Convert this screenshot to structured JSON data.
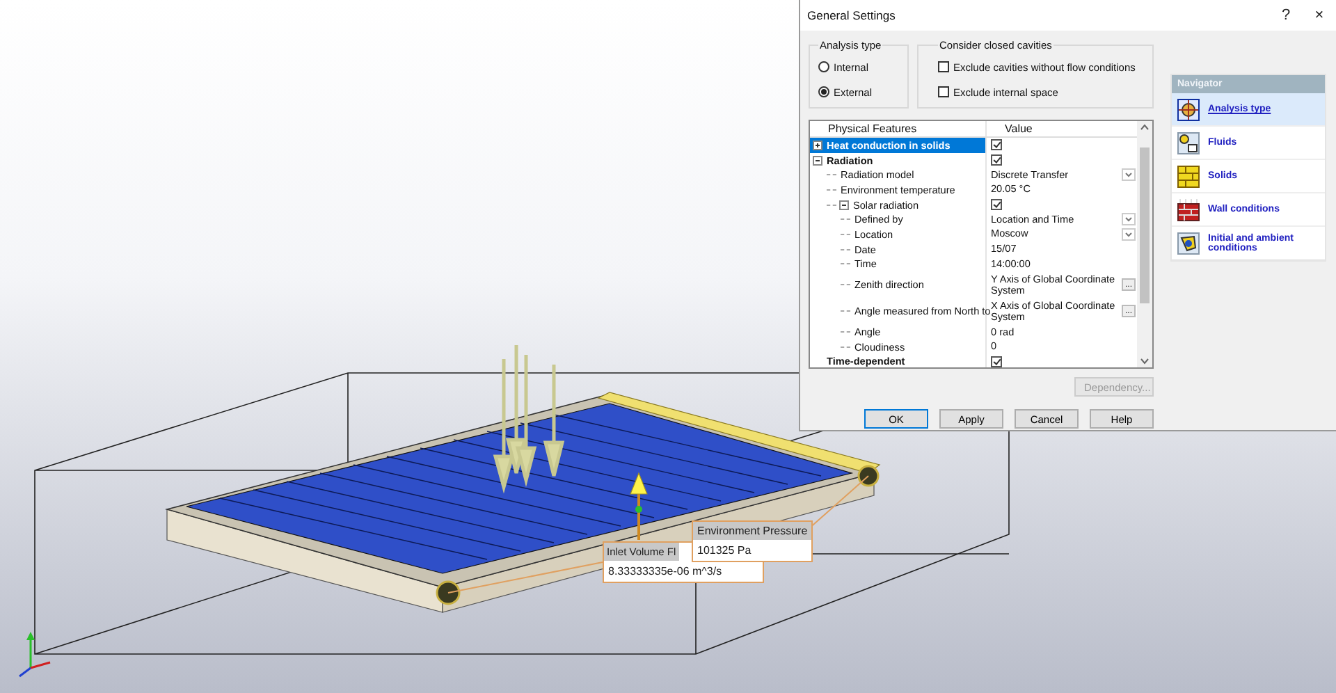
{
  "viewport": {
    "callouts": [
      {
        "title": "Environment Pressure",
        "value": "101325 Pa"
      },
      {
        "title": "Inlet Volume Fl",
        "value": "8.33333335e-06 m^3/s"
      }
    ]
  },
  "dialog": {
    "title": "General Settings",
    "help_button": "?",
    "close_button": "×",
    "analysis_type": {
      "label": "Analysis type",
      "options": [
        {
          "label": "Internal",
          "selected": false
        },
        {
          "label": "External",
          "selected": true
        }
      ]
    },
    "closed_cavities": {
      "label": "Consider closed cavities",
      "options": [
        {
          "label": "Exclude cavities without flow conditions",
          "checked": false
        },
        {
          "label": "Exclude internal space",
          "checked": false
        }
      ]
    },
    "features": {
      "columns": [
        "Physical Features",
        "Value"
      ],
      "rows": [
        {
          "label": "Heat conduction in solids",
          "kind": "check",
          "checked": true,
          "selected": true,
          "expanded": false
        },
        {
          "label": "Radiation",
          "kind": "check",
          "checked": true,
          "selected": false,
          "expanded": true,
          "children": [
            {
              "label": "Radiation model",
              "kind": "dropdown",
              "value": "Discrete Transfer",
              "selected": false
            },
            {
              "label": "Environment temperature",
              "kind": "text",
              "value": "20.05 °C",
              "selected": false
            },
            {
              "label": "Solar radiation",
              "kind": "check",
              "checked": true,
              "selected": false,
              "expanded": true,
              "children": [
                {
                  "label": "Defined by",
                  "kind": "dropdown",
                  "value": "Location and Time",
                  "selected": false
                },
                {
                  "label": "Location",
                  "kind": "dropdown",
                  "value": "Moscow",
                  "selected": false
                },
                {
                  "label": "Date",
                  "kind": "text",
                  "value": "15/07",
                  "selected": false
                },
                {
                  "label": "Time",
                  "kind": "text",
                  "value": "14:00:00",
                  "selected": false
                },
                {
                  "label": "Zenith direction",
                  "kind": "browse",
                  "value": "Y  Axis of Global Coordinate System",
                  "button_label": "...",
                  "selected": false
                },
                {
                  "label": "Angle measured from North to",
                  "kind": "browse",
                  "value": "X  Axis of Global Coordinate System",
                  "button_label": "...",
                  "selected": false
                },
                {
                  "label": "Angle",
                  "kind": "text",
                  "value": "0 rad",
                  "selected": false
                },
                {
                  "label": "Cloudiness",
                  "kind": "text",
                  "value": "0",
                  "selected": false
                }
              ]
            }
          ]
        },
        {
          "label": "Time-dependent",
          "kind": "check",
          "checked": true,
          "selected": false
        }
      ]
    },
    "dependency_button": {
      "label": "Dependency...",
      "disabled": true
    },
    "buttons": [
      "OK",
      "Apply",
      "Cancel",
      "Help"
    ],
    "navigator": {
      "title": "Navigator",
      "items": [
        {
          "label": "Analysis type",
          "selected": true
        },
        {
          "label": "Fluids",
          "selected": false
        },
        {
          "label": "Solids",
          "selected": false
        },
        {
          "label": "Wall conditions",
          "selected": false
        },
        {
          "label": "Initial and ambient conditions",
          "selected": false
        }
      ]
    }
  }
}
